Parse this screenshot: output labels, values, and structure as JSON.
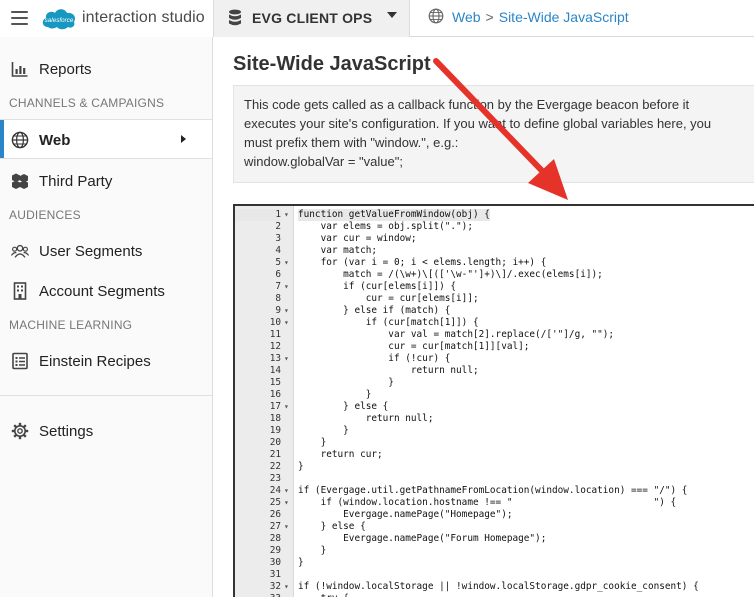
{
  "app": {
    "brand_logo_text": "salesforce",
    "brand_name": "interaction studio",
    "org_name": "EVG CLIENT OPS"
  },
  "breadcrumb": {
    "parent": "Web",
    "separator": ">",
    "current": "Site-Wide JavaScript"
  },
  "sidebar": {
    "reports": "Reports",
    "section_channels": "CHANNELS & CAMPAIGNS",
    "web": "Web",
    "third_party": "Third Party",
    "section_audiences": "AUDIENCES",
    "user_segments": "User Segments",
    "account_segments": "Account Segments",
    "section_ml": "MACHINE LEARNING",
    "einstein_recipes": "Einstein Recipes",
    "settings": "Settings"
  },
  "page": {
    "title": "Site-Wide JavaScript",
    "info_lines": [
      "This code gets called as a callback function by the Evergage beacon before it",
      "executes your site's configuration. If you want to define global variables here, you",
      "must prefix them with \"window.\", e.g.:",
      "window.globalVar = \"value\";"
    ]
  },
  "colors": {
    "accent": "#2a86c8",
    "arrow": "#e5332a"
  },
  "editor": {
    "highlighted_line": 1,
    "lines": [
      {
        "n": "1",
        "f": "▾",
        "t": "function getValueFromWindow(obj) {"
      },
      {
        "n": "2",
        "f": "",
        "t": "    var elems = obj.split(\".\");"
      },
      {
        "n": "3",
        "f": "",
        "t": "    var cur = window;"
      },
      {
        "n": "4",
        "f": "",
        "t": "    var match;"
      },
      {
        "n": "5",
        "f": "▾",
        "t": "    for (var i = 0; i < elems.length; i++) {"
      },
      {
        "n": "6",
        "f": "",
        "t": "        match = /(\\w+)\\[(['\\w-\"']+)\\]/.exec(elems[i]);"
      },
      {
        "n": "7",
        "f": "▾",
        "t": "        if (cur[elems[i]]) {"
      },
      {
        "n": "8",
        "f": "",
        "t": "            cur = cur[elems[i]];"
      },
      {
        "n": "9",
        "f": "▾",
        "t": "        } else if (match) {"
      },
      {
        "n": "10",
        "f": "▾",
        "t": "            if (cur[match[1]]) {"
      },
      {
        "n": "11",
        "f": "",
        "t": "                var val = match[2].replace(/['\"]/g, \"\");"
      },
      {
        "n": "12",
        "f": "",
        "t": "                cur = cur[match[1]][val];"
      },
      {
        "n": "13",
        "f": "▾",
        "t": "                if (!cur) {"
      },
      {
        "n": "14",
        "f": "",
        "t": "                    return null;"
      },
      {
        "n": "15",
        "f": "",
        "t": "                }"
      },
      {
        "n": "16",
        "f": "",
        "t": "            }"
      },
      {
        "n": "17",
        "f": "▾",
        "t": "        } else {"
      },
      {
        "n": "18",
        "f": "",
        "t": "            return null;"
      },
      {
        "n": "19",
        "f": "",
        "t": "        }"
      },
      {
        "n": "20",
        "f": "",
        "t": "    }"
      },
      {
        "n": "21",
        "f": "",
        "t": "    return cur;"
      },
      {
        "n": "22",
        "f": "",
        "t": "}"
      },
      {
        "n": "23",
        "f": "",
        "t": ""
      },
      {
        "n": "24",
        "f": "▾",
        "t": "if (Evergage.util.getPathnameFromLocation(window.location) === \"/\") {"
      },
      {
        "n": "25",
        "f": "▾",
        "t": "    if (window.location.hostname !== \"                         \") {"
      },
      {
        "n": "26",
        "f": "",
        "t": "        Evergage.namePage(\"Homepage\");"
      },
      {
        "n": "27",
        "f": "▾",
        "t": "    } else {"
      },
      {
        "n": "28",
        "f": "",
        "t": "        Evergage.namePage(\"Forum Homepage\");"
      },
      {
        "n": "29",
        "f": "",
        "t": "    }"
      },
      {
        "n": "30",
        "f": "",
        "t": "}"
      },
      {
        "n": "31",
        "f": "",
        "t": ""
      },
      {
        "n": "32",
        "f": "▾",
        "t": "if (!window.localStorage || !window.localStorage.gdpr_cookie_consent) {"
      },
      {
        "n": "33",
        "f": "▾",
        "t": "    try {"
      }
    ]
  }
}
